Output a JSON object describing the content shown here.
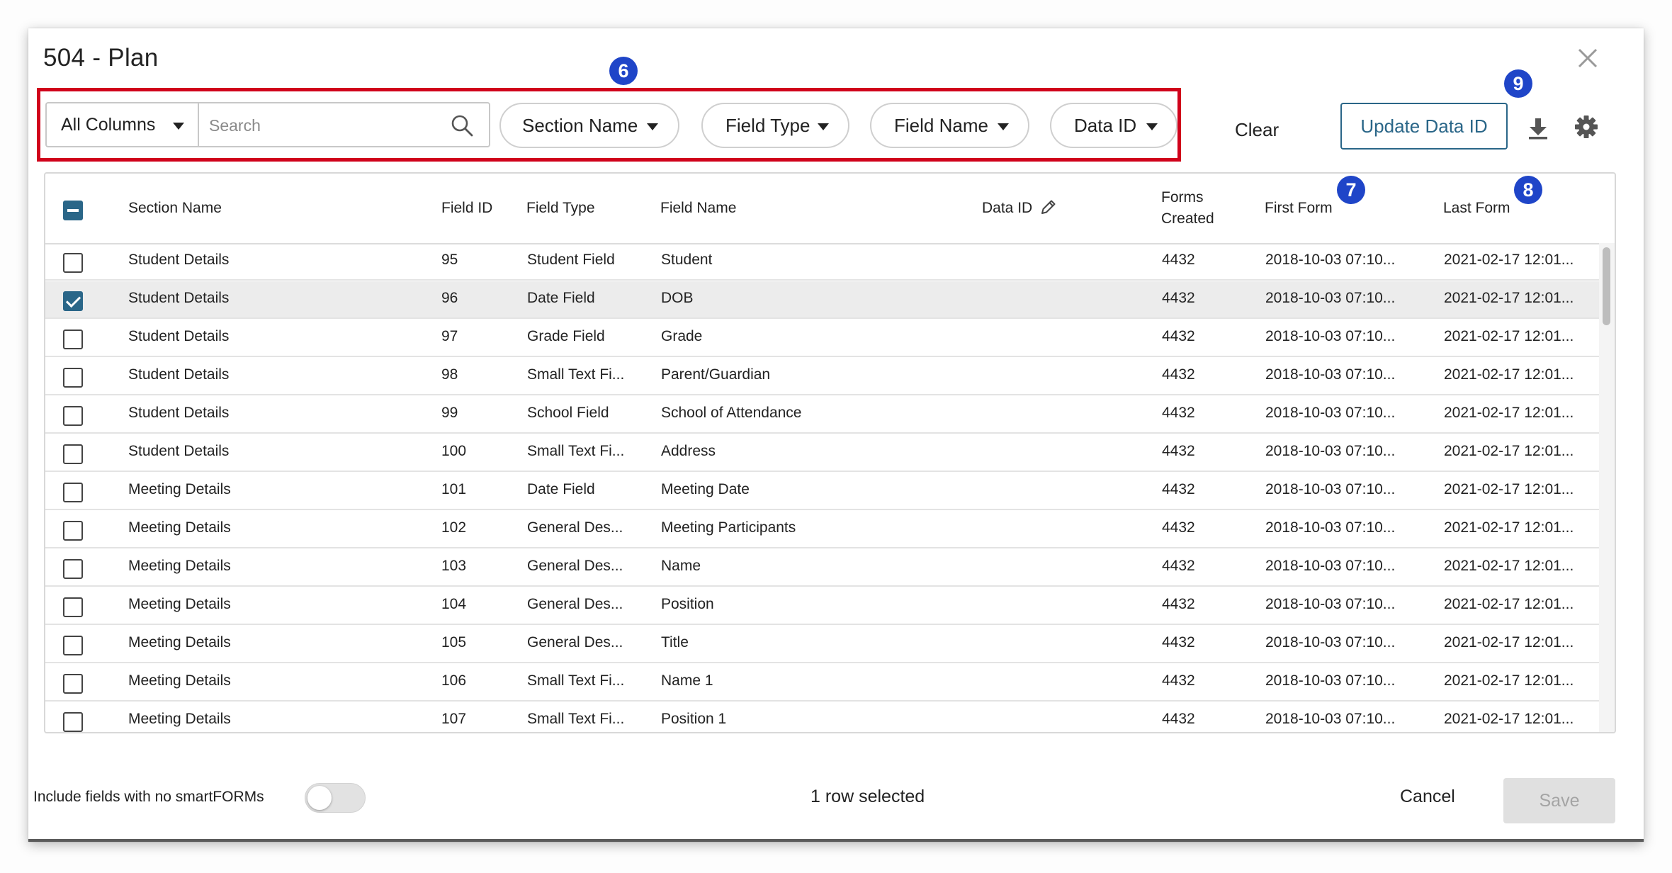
{
  "dialog": {
    "title": "504 - Plan"
  },
  "filters": {
    "column_select": "All Columns",
    "search_placeholder": "Search",
    "pills": [
      "Section Name",
      "Field Type",
      "Field Name",
      "Data ID"
    ],
    "clear_label": "Clear",
    "update_button": "Update Data ID"
  },
  "badges": [
    "6",
    "7",
    "8",
    "9"
  ],
  "table": {
    "headers": {
      "section_name": "Section Name",
      "field_id": "Field ID",
      "field_type": "Field Type",
      "field_name": "Field Name",
      "data_id": "Data ID",
      "forms_created_1": "Forms",
      "forms_created_2": "Created",
      "first_form": "First Form",
      "last_form": "Last Form"
    },
    "rows": [
      {
        "section": "Student Details",
        "field_id": "95",
        "field_type": "Student Field",
        "field_name": "Student",
        "data_id": "",
        "forms_created": "4432",
        "first_form": "2018-10-03 07:10...",
        "last_form": "2021-02-17 12:01...",
        "checked": false
      },
      {
        "section": "Student Details",
        "field_id": "96",
        "field_type": "Date Field",
        "field_name": "DOB",
        "data_id": "",
        "forms_created": "4432",
        "first_form": "2018-10-03 07:10...",
        "last_form": "2021-02-17 12:01...",
        "checked": true
      },
      {
        "section": "Student Details",
        "field_id": "97",
        "field_type": "Grade Field",
        "field_name": "Grade",
        "data_id": "",
        "forms_created": "4432",
        "first_form": "2018-10-03 07:10...",
        "last_form": "2021-02-17 12:01...",
        "checked": false
      },
      {
        "section": "Student Details",
        "field_id": "98",
        "field_type": "Small Text Fi...",
        "field_name": "Parent/Guardian",
        "data_id": "",
        "forms_created": "4432",
        "first_form": "2018-10-03 07:10...",
        "last_form": "2021-02-17 12:01...",
        "checked": false
      },
      {
        "section": "Student Details",
        "field_id": "99",
        "field_type": "School Field",
        "field_name": "School of Attendance",
        "data_id": "",
        "forms_created": "4432",
        "first_form": "2018-10-03 07:10...",
        "last_form": "2021-02-17 12:01...",
        "checked": false
      },
      {
        "section": "Student Details",
        "field_id": "100",
        "field_type": "Small Text Fi...",
        "field_name": "Address",
        "data_id": "",
        "forms_created": "4432",
        "first_form": "2018-10-03 07:10...",
        "last_form": "2021-02-17 12:01...",
        "checked": false
      },
      {
        "section": "Meeting Details",
        "field_id": "101",
        "field_type": "Date Field",
        "field_name": "Meeting Date",
        "data_id": "",
        "forms_created": "4432",
        "first_form": "2018-10-03 07:10...",
        "last_form": "2021-02-17 12:01...",
        "checked": false
      },
      {
        "section": "Meeting Details",
        "field_id": "102",
        "field_type": "General Des...",
        "field_name": "Meeting Participants",
        "data_id": "",
        "forms_created": "4432",
        "first_form": "2018-10-03 07:10...",
        "last_form": "2021-02-17 12:01...",
        "checked": false
      },
      {
        "section": "Meeting Details",
        "field_id": "103",
        "field_type": "General Des...",
        "field_name": "Name",
        "data_id": "",
        "forms_created": "4432",
        "first_form": "2018-10-03 07:10...",
        "last_form": "2021-02-17 12:01...",
        "checked": false
      },
      {
        "section": "Meeting Details",
        "field_id": "104",
        "field_type": "General Des...",
        "field_name": "Position",
        "data_id": "",
        "forms_created": "4432",
        "first_form": "2018-10-03 07:10...",
        "last_form": "2021-02-17 12:01...",
        "checked": false
      },
      {
        "section": "Meeting Details",
        "field_id": "105",
        "field_type": "General Des...",
        "field_name": "Title",
        "data_id": "",
        "forms_created": "4432",
        "first_form": "2018-10-03 07:10...",
        "last_form": "2021-02-17 12:01...",
        "checked": false
      },
      {
        "section": "Meeting Details",
        "field_id": "106",
        "field_type": "Small Text Fi...",
        "field_name": "Name 1",
        "data_id": "",
        "forms_created": "4432",
        "first_form": "2018-10-03 07:10...",
        "last_form": "2021-02-17 12:01...",
        "checked": false
      },
      {
        "section": "Meeting Details",
        "field_id": "107",
        "field_type": "Small Text Fi...",
        "field_name": "Position 1",
        "data_id": "",
        "forms_created": "4432",
        "first_form": "2018-10-03 07:10...",
        "last_form": "2021-02-17 12:01...",
        "checked": false
      }
    ]
  },
  "footer": {
    "toggle_label": "Include fields with no smartFORMs",
    "toggle_on": false,
    "selected_text": "1 row selected",
    "cancel_label": "Cancel",
    "save_label": "Save"
  },
  "icons": {
    "close": "close-icon",
    "search": "search-icon",
    "download": "download-icon",
    "settings": "gear-icon",
    "edit": "pencil-icon",
    "dropdown": "caret-down-icon"
  },
  "colors": {
    "accent": "#2a6688",
    "highlight": "#d0021b",
    "badge": "#1f45c8",
    "selected_row": "#ececec"
  }
}
